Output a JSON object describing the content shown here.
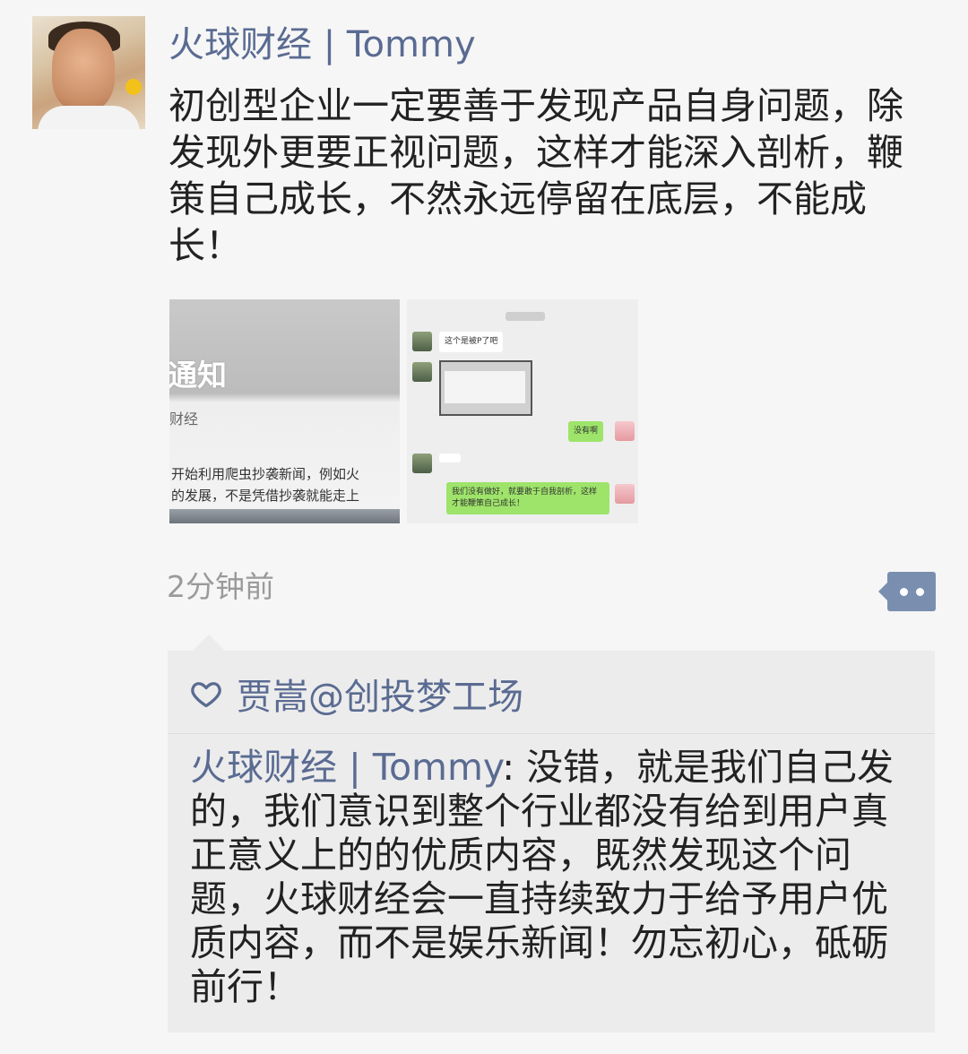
{
  "post": {
    "author": "火球财经 | Tommy",
    "text": "初创型企业一定要善于发现产品自身问题，除发现外更要正视问题，这样才能深入剖析，鞭策自己成长，不然永远停留在底层，不能成长！",
    "timestamp": "2分钟前"
  },
  "images": [
    {
      "lines": [
        "通知",
        "财经",
        "开始利用爬虫抄袭新闻，例如火",
        "的发展，不是凭借抄袭就能走上"
      ]
    },
    {
      "chat": [
        "这个是被P了吧",
        "没有啊",
        "我们没有做好，就要敢于自我剖析，",
        "这样才能鞭策自己成长！"
      ]
    }
  ],
  "likes": {
    "names": "贾嵩@创投梦工场"
  },
  "comment": {
    "author": "火球财经 | Tommy",
    "separator": ": ",
    "text": "没错，就是我们自己发的，我们意识到整个行业都没有给到用户真正意义上的的优质内容，既然发现这个问题，火球财经会一直持续致力于给予用户优质内容，而不是娱乐新闻！勿忘初心，砥砺前行！"
  },
  "colors": {
    "link": "#5a6b92",
    "background": "#f6f6f6",
    "comment_bg": "#ececec",
    "more_button": "#7a8fb0"
  },
  "icons": {
    "like": "heart-icon",
    "more": "more-dots-icon"
  }
}
